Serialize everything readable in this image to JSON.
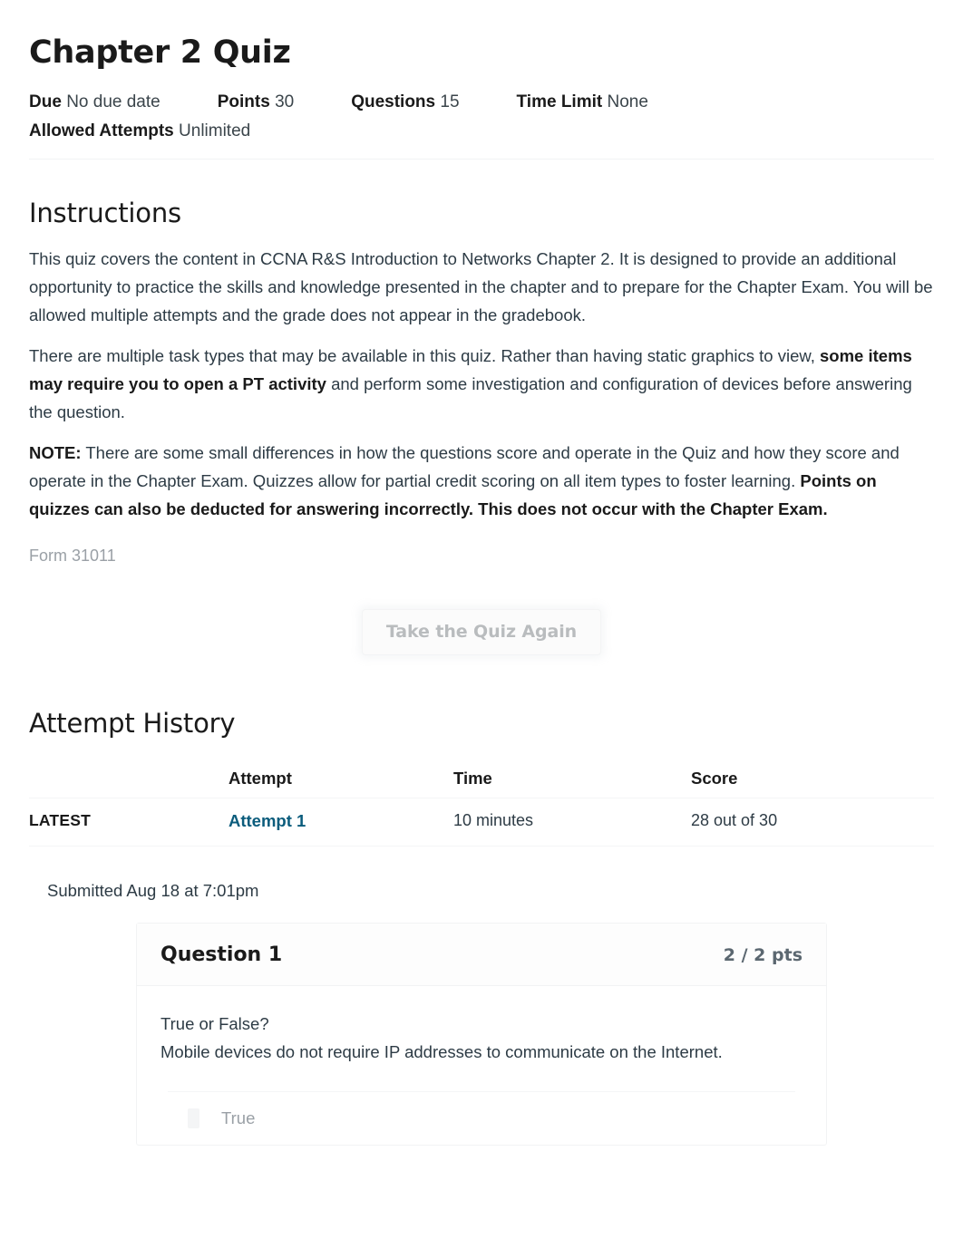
{
  "quiz": {
    "title": "Chapter 2 Quiz",
    "meta": [
      {
        "label": "Due",
        "value": "No due date"
      },
      {
        "label": "Points",
        "value": "30"
      },
      {
        "label": "Questions",
        "value": "15"
      },
      {
        "label": "Time Limit",
        "value": "None"
      }
    ],
    "meta_second_line": [
      {
        "label": "Allowed Attempts",
        "value": "Unlimited"
      }
    ]
  },
  "instructions": {
    "heading": "Instructions",
    "paragraph_1": "This quiz covers the content in CCNA R&S Introduction to Networks Chapter 2. It is designed to provide an additional opportunity to practice the skills and knowledge presented in the chapter and to prepare for the Chapter Exam. You will be allowed multiple attempts and the grade does not appear in the gradebook.",
    "paragraph_2_part_1": "There are multiple task types that may be available in this quiz. Rather than having static graphics to view, ",
    "paragraph_2_bold": "some items may require you to open a PT activity",
    "paragraph_2_part_2": " and perform some investigation and configuration of devices before answering the question.",
    "paragraph_3_bold_1": "NOTE:",
    "paragraph_3_part_1": " There are some small differences in how the questions score and operate in the Quiz and how they score and operate in the Chapter Exam. Quizzes allow for partial credit scoring on all item types to foster learning. ",
    "paragraph_3_bold_2": "Points on quizzes can also be deducted for answering incorrectly. This does not occur with the Chapter Exam.",
    "form_id": "Form 31011"
  },
  "actions": {
    "retake_label": "Take the Quiz Again"
  },
  "attempt_history": {
    "heading": "Attempt History",
    "columns": [
      "",
      "Attempt",
      "Time",
      "Score"
    ],
    "rows": [
      {
        "kept": "LATEST",
        "attempt": "Attempt 1",
        "time": "10 minutes",
        "score": "28 out of 30"
      }
    ]
  },
  "submission": {
    "submitted_text": "Submitted Aug 18 at 7:01pm"
  },
  "question": {
    "name": "Question 1",
    "points": "2 / 2 pts",
    "prompt_line_1": "True or False?",
    "prompt_line_2": "Mobile devices do not require IP addresses to communicate on the Internet.",
    "answers": [
      {
        "text": "True"
      }
    ]
  },
  "colors": {
    "link": "#0b5c7c",
    "text": "#2d3b45",
    "muted": "#9aa0a6",
    "heading": "#1a1a1a",
    "border": "#f2f3f4"
  }
}
